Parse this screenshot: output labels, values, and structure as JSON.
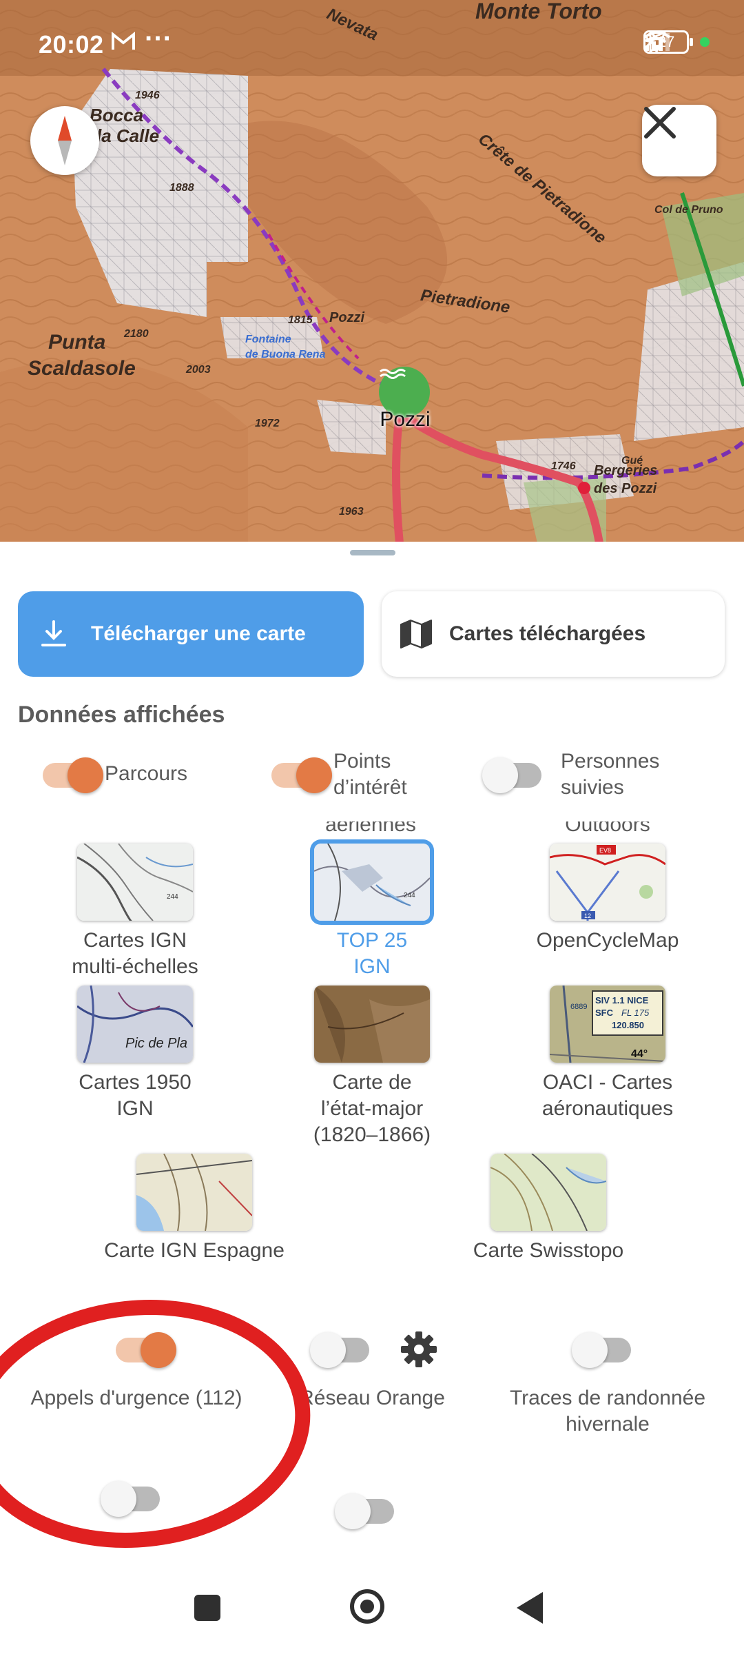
{
  "status_bar": {
    "time": "20:02",
    "mail_icon": "gmail-icon",
    "more": "···",
    "battery": "27"
  },
  "map": {
    "place_labels": [
      "Nevata",
      "Monte Torto",
      "Bocca",
      "la Calle",
      "Punta",
      "Scaldasole",
      "Crête de Pietradione",
      "Pietradione",
      "Col de Pruno",
      "Bergeries",
      "des Pozzi",
      "Pozzi",
      "Fontaine",
      "de Buona Rena",
      "1946",
      "1888",
      "1972",
      "1963",
      "2003",
      "2180",
      "1815",
      "1746",
      "Gué"
    ],
    "poi_label": "Pozzi"
  },
  "sheet": {
    "download_label": "Télécharger une carte",
    "downloaded_label": "Cartes téléchargées",
    "section_title": "Données affichées",
    "toggles": [
      {
        "label": "Parcours",
        "on": true
      },
      {
        "label_line1": "Points",
        "label_line2": "d’intérêt",
        "on": true
      },
      {
        "label_line1": "Personnes",
        "label_line2": "suivies",
        "on": false
      }
    ],
    "cutoff_labels": [
      "aériennes",
      "Outdoors"
    ],
    "layers": [
      {
        "line1": "Cartes IGN",
        "line2": "multi-échelles",
        "selected": false
      },
      {
        "line1": "TOP 25",
        "line2": "IGN",
        "selected": true
      },
      {
        "line1": "OpenCycleMap",
        "selected": false
      },
      {
        "line1": "Cartes 1950",
        "line2": "IGN",
        "selected": false
      },
      {
        "line1": "Carte de",
        "line2": "l’état-major",
        "line3": "(1820–1866)",
        "selected": false
      },
      {
        "line1": "OACI - Cartes",
        "line2": "aéronautiques",
        "selected": false
      },
      {
        "line1": "Carte IGN Espagne",
        "selected": false
      },
      {
        "line1": "Carte Swisstopo",
        "selected": false
      }
    ],
    "oaci_thumb_text": [
      "SIV 1.1 NICE",
      "SFC",
      "FL 175",
      "120.850",
      "6889",
      "44°"
    ],
    "thumb_texts": {
      "ign": "244",
      "ign1950": "Pic de Pla",
      "opencycle_badge": "EV8",
      "opencycle_road": "12"
    },
    "bottom_toggles": [
      {
        "label": "Appels d'urgence (112)",
        "on": true
      },
      {
        "label": "Réseau Orange",
        "on": false
      },
      {
        "label_line1": "Traces de randonnée",
        "label_line2": "hivernale",
        "on": false
      }
    ],
    "colors": {
      "accent": "#4f9de8",
      "toggle_on": "#e37a45",
      "annotation": "#e02020"
    }
  }
}
